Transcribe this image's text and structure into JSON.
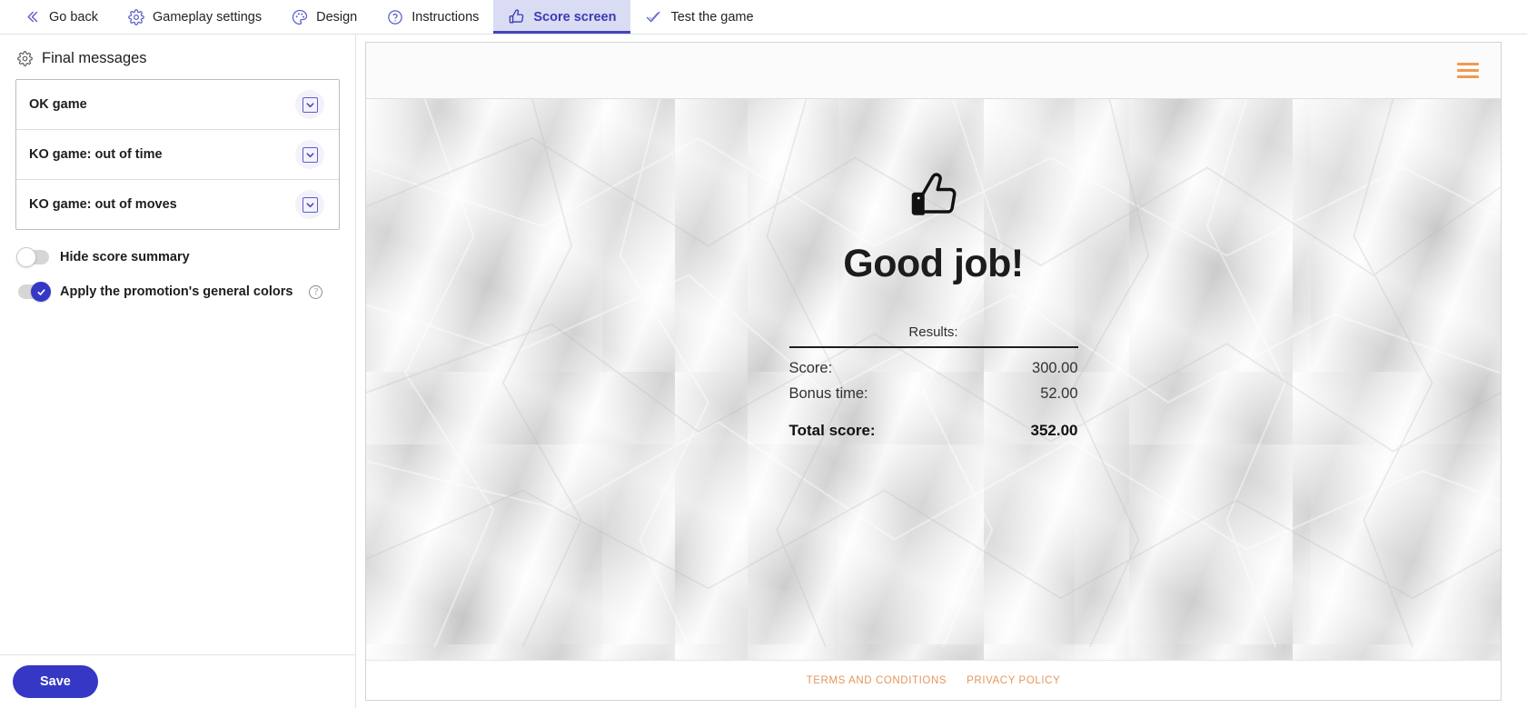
{
  "topbar": {
    "tabs": [
      {
        "label": "Go back",
        "icon": "chevron-double-left-icon",
        "active": false
      },
      {
        "label": "Gameplay settings",
        "icon": "gear-icon",
        "active": false
      },
      {
        "label": "Design",
        "icon": "palette-icon",
        "active": false
      },
      {
        "label": "Instructions",
        "icon": "question-circle-icon",
        "active": false
      },
      {
        "label": "Score screen",
        "icon": "thumbs-up-icon",
        "active": true
      },
      {
        "label": "Test the game",
        "icon": "check-icon",
        "active": false
      }
    ]
  },
  "sidebar": {
    "panel_title": "Final messages",
    "panel_icon": "gear-icon",
    "messages": [
      {
        "label": "OK game"
      },
      {
        "label": "KO game: out of time"
      },
      {
        "label": "KO game: out of moves"
      }
    ],
    "toggles": [
      {
        "label": "Hide score summary",
        "state": "off",
        "help": false
      },
      {
        "label": "Apply the promotion's general colors",
        "state": "on",
        "help": true
      }
    ],
    "save_label": "Save"
  },
  "preview": {
    "menu_icon": "hamburger-menu-icon",
    "result_icon": "thumbs-up-icon",
    "headline": "Good job!",
    "results_title": "Results:",
    "rows": [
      {
        "label": "Score:",
        "value": "300.00"
      },
      {
        "label": "Bonus time:",
        "value": "52.00"
      }
    ],
    "total": {
      "label": "Total score:",
      "value": "352.00"
    },
    "footer_links": [
      {
        "label": "TERMS AND CONDITIONS"
      },
      {
        "label": "PRIVACY POLICY"
      }
    ]
  },
  "colors": {
    "accent_indigo": "#3538c4",
    "tab_active_bg": "#d9dcf3",
    "orange": "#ef9a4e",
    "footer_link": "#e3975d"
  }
}
